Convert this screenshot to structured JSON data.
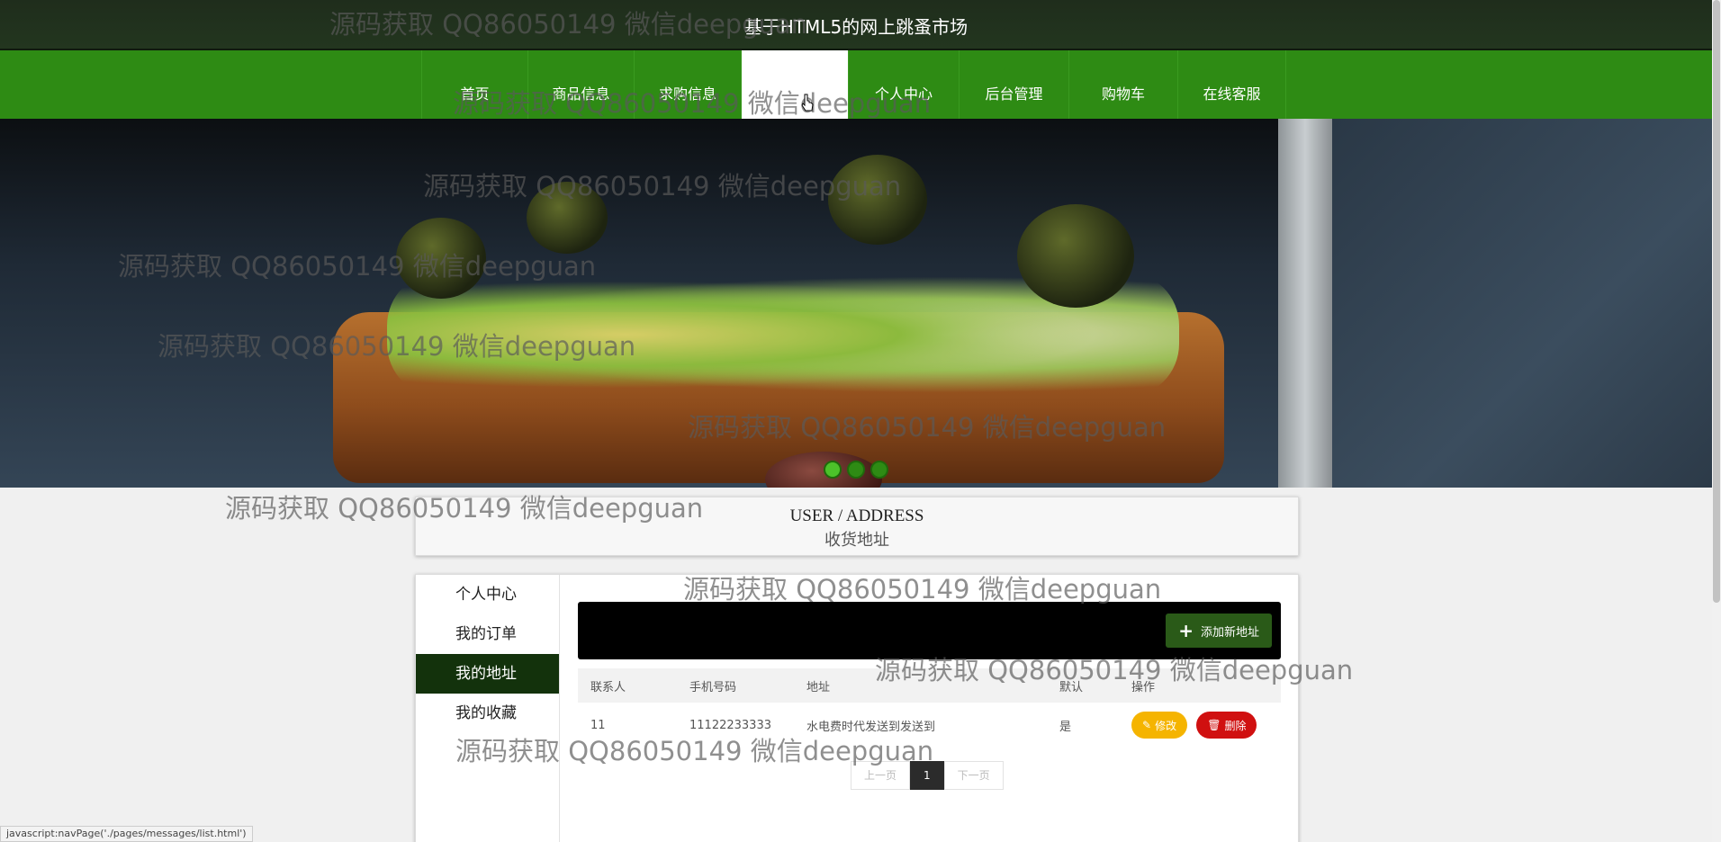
{
  "site": {
    "title": "基于HTML5的网上跳蚤市场"
  },
  "nav": {
    "items": [
      {
        "label": "首页"
      },
      {
        "label": "商品信息"
      },
      {
        "label": "求购信息"
      },
      {
        "label": ""
      },
      {
        "label": "个人中心"
      },
      {
        "label": "后台管理"
      },
      {
        "label": "购物车"
      },
      {
        "label": "在线客服"
      }
    ]
  },
  "banner": {
    "dots": 3,
    "active_dot": 1
  },
  "address_header": {
    "en": "USER / ADDRESS",
    "cn": "收货地址"
  },
  "sidebar": {
    "items": [
      {
        "label": "个人中心"
      },
      {
        "label": "我的订单"
      },
      {
        "label": "我的地址"
      },
      {
        "label": "我的收藏"
      }
    ],
    "active": "我的地址"
  },
  "toolbar": {
    "add_label": "添加新地址"
  },
  "table": {
    "headers": [
      "联系人",
      "手机号码",
      "地址",
      "默认",
      "操作"
    ],
    "rows": [
      {
        "contact": "11",
        "phone": "11122233333",
        "address": "水电费时代发送到发送到",
        "default": "是",
        "edit": "修改",
        "delete": "删除"
      }
    ]
  },
  "pagination": {
    "prev": "上一页",
    "current": "1",
    "next": "下一页"
  },
  "status_bar": {
    "text": "javascript:navPage('./pages/messages/list.html')"
  },
  "watermark": {
    "text": "源码获取 QQ86050149 微信deepguan"
  },
  "colors": {
    "nav_green": "#2e8b14",
    "topbar": "#23361f",
    "edit": "#f5b400",
    "delete": "#d01010",
    "add": "#2a5a18"
  }
}
